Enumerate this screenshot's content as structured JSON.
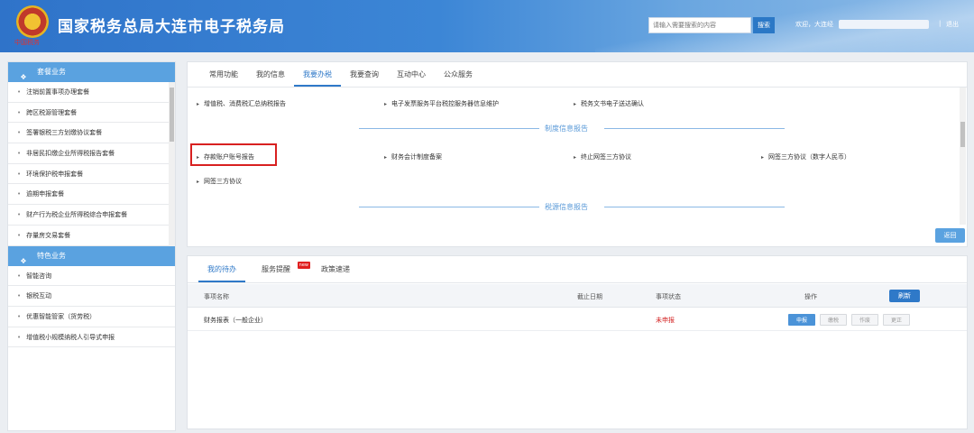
{
  "header": {
    "site_title": "国家税务总局大连市电子税务局",
    "emblem_text": "中国税务",
    "search_placeholder": "请输入需要搜索的内容",
    "search_button": "搜索",
    "welcome": "欢迎，大连经",
    "separator": "|",
    "logout": "退出"
  },
  "sidebar": {
    "section1_title": "套餐业务",
    "section1_items": [
      "注销前置事项办理套餐",
      "跨区税源管理套餐",
      "签署银税三方划缴协议套餐",
      "非居民扣缴企业所得税报告套餐",
      "环境保护税申报套餐",
      "逾期申报套餐",
      "财产行为税企业所得税综合申报套餐",
      "存量房交易套餐"
    ],
    "section2_title": "特色业务",
    "section2_items": [
      "智能咨询",
      "银税互动",
      "优惠智能管家（货劳税）",
      "增值税小规模纳税人引导式申报"
    ]
  },
  "main": {
    "tabs": [
      "常用功能",
      "我的信息",
      "我要办税",
      "我要查询",
      "互动中心",
      "公众服务"
    ],
    "active_tab": "我要办税",
    "row1": [
      "增值税、消费税汇总纳税报告",
      "电子发票服务平台税控服务器信息维护",
      "税务文书电子送达确认"
    ],
    "section_system": "制度信息报告",
    "row2": [
      "存款账户账号报告",
      "财务会计制度备案",
      "终止网签三方协议",
      "网签三方协议（数字人民币）"
    ],
    "row3": [
      "网签三方协议"
    ],
    "section_source": "税源信息报告",
    "back_button": "返回"
  },
  "todo": {
    "tabs": [
      "我的待办",
      "服务提醒",
      "政策速递"
    ],
    "new_badge": "new",
    "columns": [
      "事项名称",
      "截止日期",
      "事项状态",
      "操作"
    ],
    "refresh_button": "刷新",
    "rows": [
      {
        "name": "财务报表（一般企业）",
        "deadline": "",
        "status": "未申报",
        "actions": [
          "申报",
          "缴税",
          "作废",
          "更正"
        ]
      }
    ]
  },
  "colors": {
    "accent": "#2f79c8",
    "sidebar_header": "#5aa2e0",
    "highlight": "#d82020",
    "status_unfiled": "#d32020"
  },
  "icons": {
    "search": "search-icon",
    "package": "package-icon",
    "feature": "feature-icon"
  }
}
